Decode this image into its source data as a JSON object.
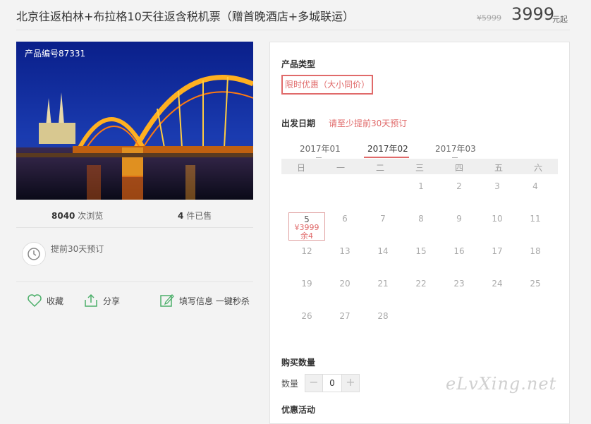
{
  "header": {
    "title": "北京往返柏林+布拉格10天往返含税机票（赠首晚酒店+多城联运）",
    "old_price": "¥5999",
    "price": "3999",
    "price_suffix": "元起"
  },
  "product": {
    "number": "产品编号87331",
    "views_count": "8040",
    "views_label": "次浏览",
    "sold_count": "4",
    "sold_label": "件已售",
    "advance_text": "提前30天预订"
  },
  "actions": {
    "favorite": "收藏",
    "share": "分享",
    "fill_info": "填写信息 一键秒杀"
  },
  "panel": {
    "product_type_label": "产品类型",
    "product_type_value": "限时优惠（大小同价）",
    "departure_label": "出发日期",
    "departure_note": "请至少提前30天预订",
    "months": [
      "2017年01",
      "2017年02",
      "2017年03"
    ],
    "active_month": "2017年02",
    "weekdays": [
      "日",
      "一",
      "二",
      "三",
      "四",
      "五",
      "六"
    ],
    "days": [
      "1",
      "2",
      "3",
      "4",
      "5",
      "6",
      "7",
      "8",
      "9",
      "10",
      "11",
      "12",
      "13",
      "14",
      "15",
      "16",
      "17",
      "18",
      "19",
      "20",
      "21",
      "22",
      "23",
      "24",
      "25",
      "26",
      "27",
      "28"
    ],
    "selected_day": {
      "day": "5",
      "price": "¥3999",
      "remaining": "余4"
    },
    "quantity_label": "购买数量",
    "quantity_field_label": "数量",
    "quantity_value": "0",
    "minus": "−",
    "plus": "+",
    "promo_label": "优惠活动"
  },
  "watermark": "eLvXing.net",
  "icons": [
    "clock-icon",
    "heart-icon",
    "share-icon",
    "edit-icon"
  ],
  "colors": {
    "accent": "#e06a6a",
    "price": "#444444"
  }
}
